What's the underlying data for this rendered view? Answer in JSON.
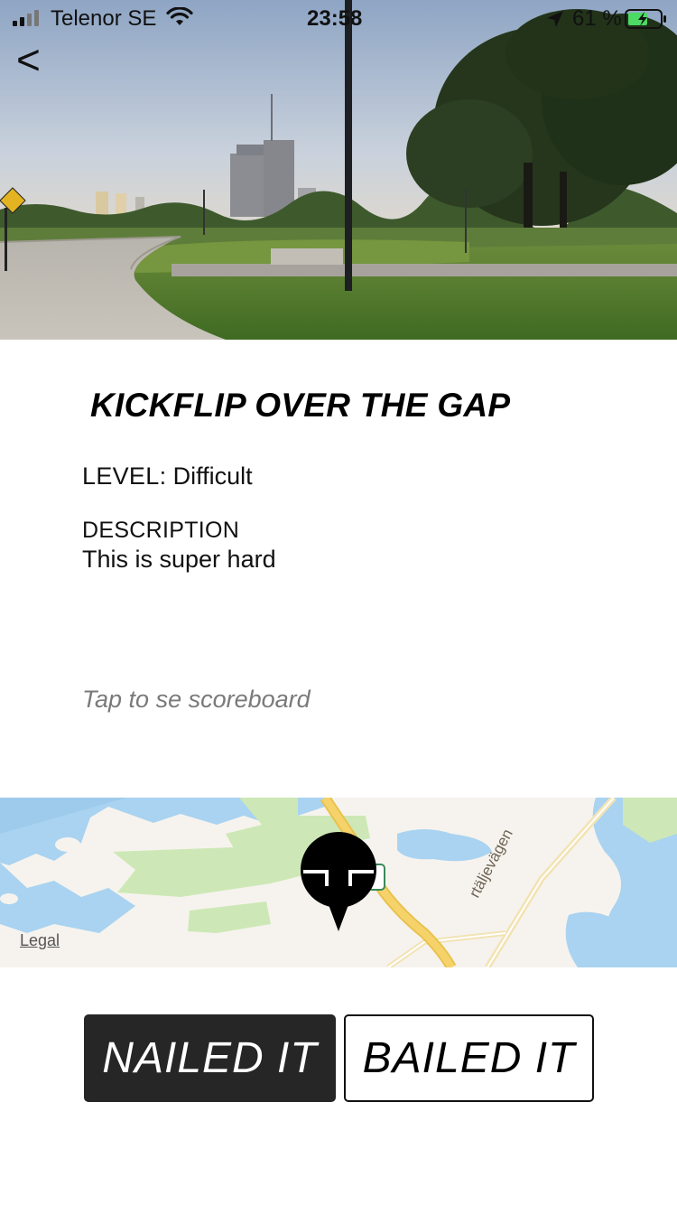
{
  "status_bar": {
    "carrier": "Telenor SE",
    "time": "23:58",
    "battery_percent": "61 %",
    "battery_level": 0.61,
    "charging": true,
    "icons": [
      "signal-icon",
      "wifi-icon",
      "location-arrow-icon",
      "battery-icon"
    ]
  },
  "nav": {
    "back_label": "<"
  },
  "spot": {
    "title": "KICKFLIP OVER THE GAP",
    "level_label": "LEVEL",
    "level_separator": ": ",
    "level_value": "Difficult",
    "description_label": "DESCRIPTION",
    "description_text": "This is super hard"
  },
  "scoreboard_link": "Tap to se scoreboard",
  "map": {
    "legal_label": "Legal",
    "road_label": "rtäljevägen",
    "colors": {
      "water": "#a9d3f0",
      "land": "#f6f3ee",
      "park": "#cde8b6",
      "road_major": "#f6d36a",
      "road_minor": "#f3e3b4"
    }
  },
  "actions": {
    "nailed_label": "NAILED IT",
    "bailed_label": "BAILED IT"
  },
  "colors": {
    "primary_button_bg": "#262626",
    "muted_text": "#7a7a7a"
  }
}
